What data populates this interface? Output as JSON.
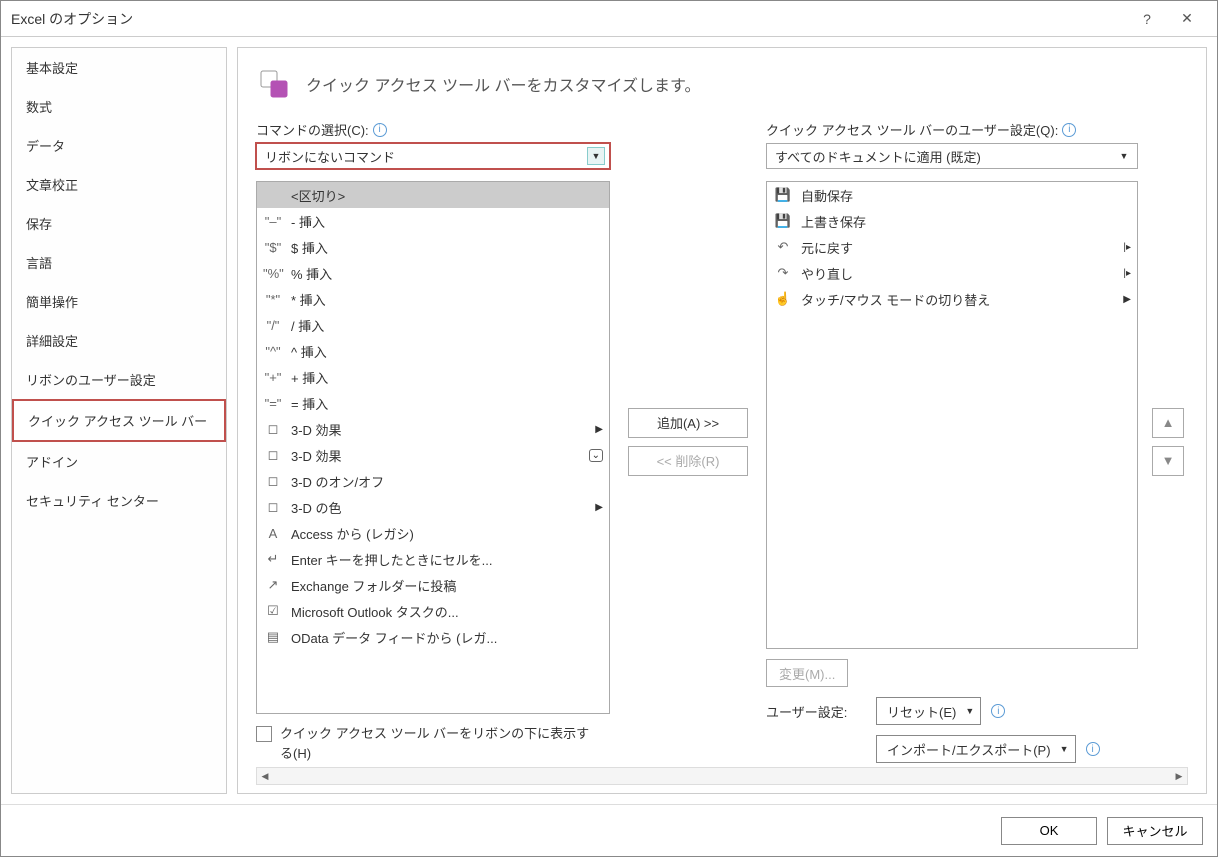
{
  "window": {
    "title": "Excel のオプション"
  },
  "sidebar": {
    "items": [
      {
        "label": "基本設定"
      },
      {
        "label": "数式"
      },
      {
        "label": "データ"
      },
      {
        "label": "文章校正"
      },
      {
        "label": "保存"
      },
      {
        "label": "言語"
      },
      {
        "label": "簡単操作"
      },
      {
        "label": "詳細設定"
      },
      {
        "label": "リボンのユーザー設定"
      },
      {
        "label": "クイック アクセス ツール バー",
        "selected": true
      },
      {
        "label": "アドイン"
      },
      {
        "label": "セキュリティ センター"
      }
    ]
  },
  "main": {
    "header": "クイック アクセス ツール バーをカスタマイズします。",
    "left": {
      "label": "コマンドの選択(C):",
      "dropdown_value": "リボンにないコマンド",
      "items": [
        {
          "icon": "",
          "label": "<区切り>",
          "selected": true
        },
        {
          "icon": "\"‒\"",
          "label": "- 挿入"
        },
        {
          "icon": "\"$\"",
          "label": "$ 挿入"
        },
        {
          "icon": "\"%\"",
          "label": "% 挿入"
        },
        {
          "icon": "\"*\"",
          "label": "* 挿入"
        },
        {
          "icon": "\"/\"",
          "label": "/ 挿入"
        },
        {
          "icon": "\"^\"",
          "label": "^ 挿入"
        },
        {
          "icon": "\"+\"",
          "label": "+ 挿入"
        },
        {
          "icon": "\"=\"",
          "label": "= 挿入"
        },
        {
          "icon": "◻",
          "label": "3-D 効果",
          "submenu": true
        },
        {
          "icon": "◻",
          "label": "3-D 効果",
          "box": true
        },
        {
          "icon": "◻",
          "label": "3-D のオン/オフ"
        },
        {
          "icon": "◻",
          "label": "3-D の色",
          "submenu": true
        },
        {
          "icon": "A",
          "label": "Access から (レガシ)"
        },
        {
          "icon": "↵",
          "label": "Enter キーを押したときにセルを..."
        },
        {
          "icon": "↗",
          "label": "Exchange フォルダーに投稿"
        },
        {
          "icon": "☑",
          "label": "Microsoft Outlook タスクの..."
        },
        {
          "icon": "▤",
          "label": "OData データ フィードから (レガ..."
        }
      ],
      "checkbox_label": "クイック アクセス ツール バーをリボンの下に表示する(H)"
    },
    "mid": {
      "add": "追加(A) >>",
      "remove": "<< 削除(R)"
    },
    "right": {
      "label": "クイック アクセス ツール バーのユーザー設定(Q):",
      "dropdown_value": "すべてのドキュメントに適用 (既定)",
      "items": [
        {
          "icon": "save-purple",
          "label": "自動保存"
        },
        {
          "icon": "save-purple",
          "label": "上書き保存"
        },
        {
          "icon": "undo",
          "label": "元に戻す",
          "split": true
        },
        {
          "icon": "redo",
          "label": "やり直し",
          "split": true
        },
        {
          "icon": "touch",
          "label": "タッチ/マウス モードの切り替え",
          "submenu": true
        }
      ],
      "modify": "変更(M)...",
      "reset_label": "ユーザー設定:",
      "reset_dd": "リセット(E)",
      "import_dd": "インポート/エクスポート(P)"
    }
  },
  "footer": {
    "ok": "OK",
    "cancel": "キャンセル"
  }
}
